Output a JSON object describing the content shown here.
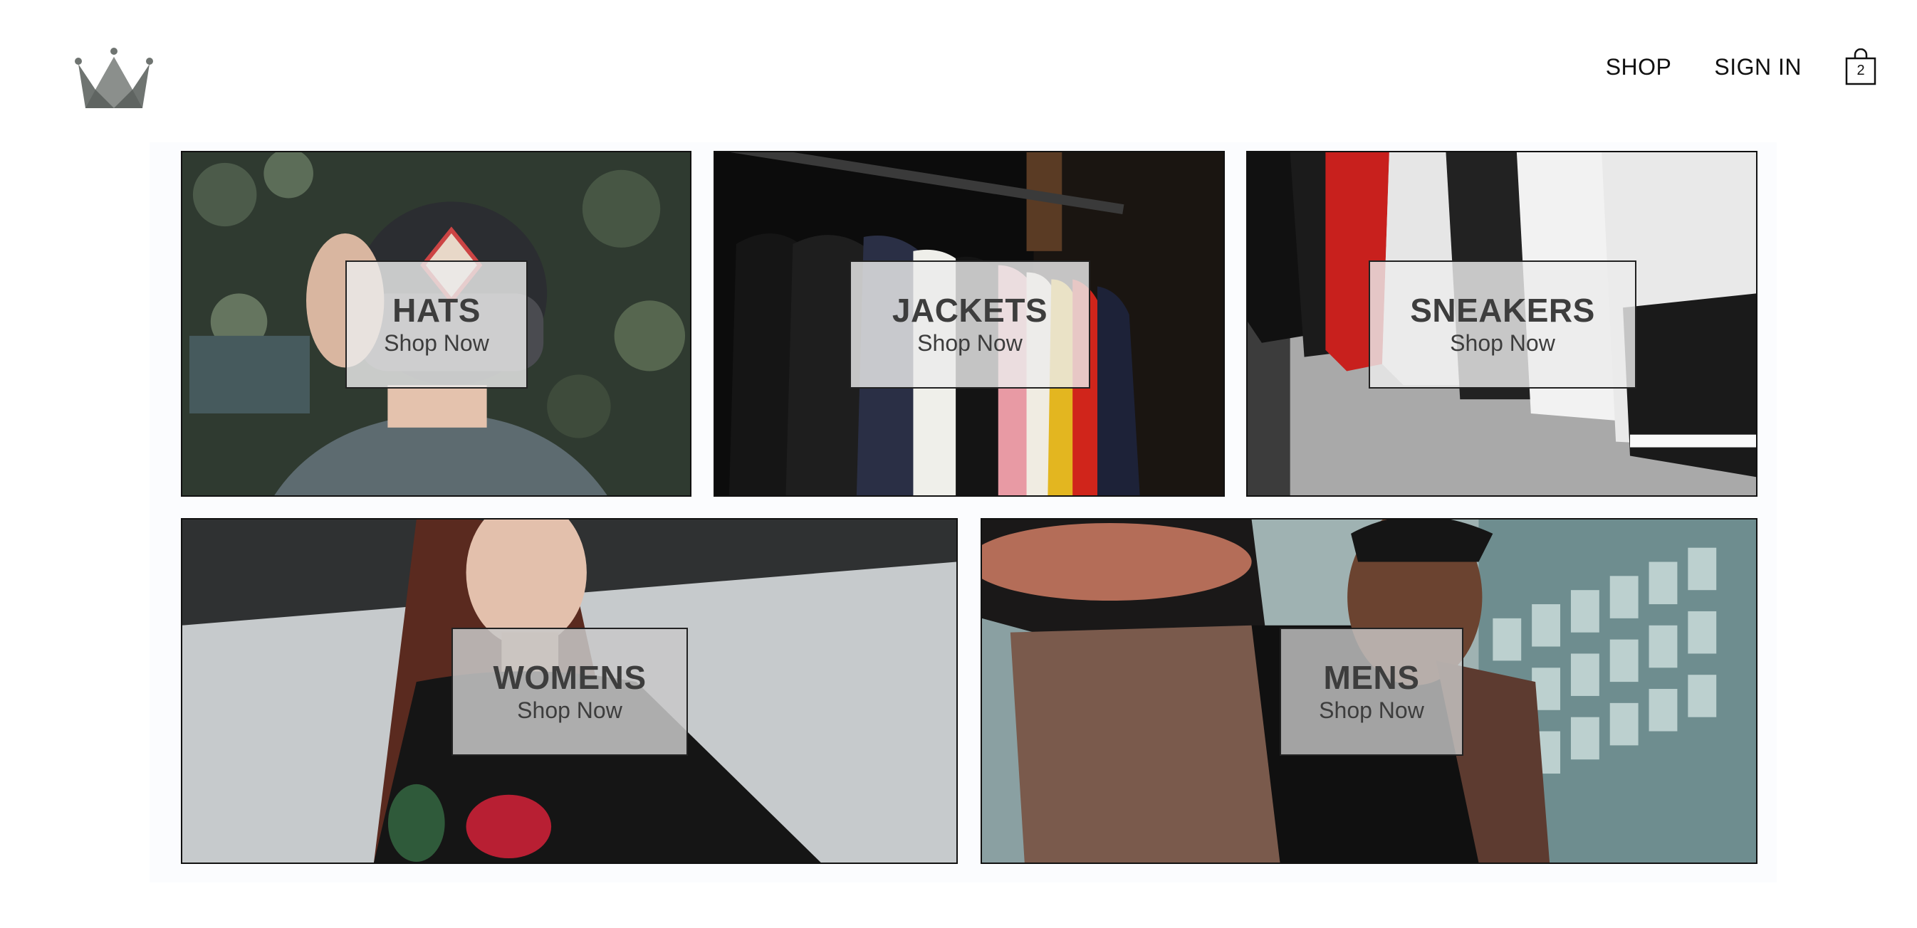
{
  "header": {
    "logo_icon": "crown-icon",
    "nav": {
      "shop": "SHOP",
      "sign_in": "SIGN IN"
    },
    "cart": {
      "icon": "shopping-bag-icon",
      "count": "2"
    }
  },
  "directory": {
    "sections": [
      {
        "title": "HATS",
        "subtitle": "Shop Now"
      },
      {
        "title": "JACKETS",
        "subtitle": "Shop Now"
      },
      {
        "title": "SNEAKERS",
        "subtitle": "Shop Now"
      },
      {
        "title": "WOMENS",
        "subtitle": "Shop Now"
      },
      {
        "title": "MENS",
        "subtitle": "Shop Now"
      }
    ]
  },
  "colors": {
    "border": "#111111",
    "label_text": "#3d3d3d",
    "logo": "#6f7471"
  }
}
